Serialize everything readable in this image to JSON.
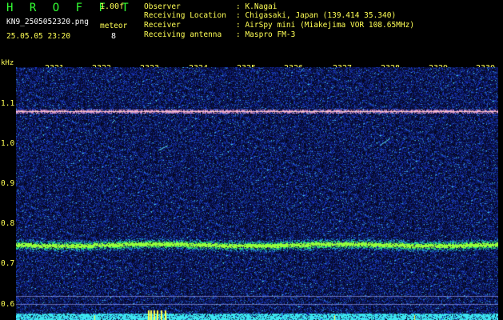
{
  "header": {
    "logo": "H R O F F T",
    "version": "1.00f",
    "filename": "KN9_2505052320.png",
    "meteor_label": "meteor",
    "datetime": "25.05.05 23:20",
    "meteor_count": "8",
    "info": [
      {
        "label": "Observer",
        "value": ": K.Nagai"
      },
      {
        "label": "Receiving Location",
        "value": ": Chigasaki, Japan (139.414 35.340)"
      },
      {
        "label": "Receiver",
        "value": ": AirSpy mini (Miakejima VOR 108.65MHz)"
      },
      {
        "label": "Receiving antenna",
        "value": ": Maspro FM-3"
      }
    ]
  },
  "axis": {
    "y_unit": "kHz",
    "x_ticks": [
      "2321",
      "2322",
      "2323",
      "2324",
      "2325",
      "2326",
      "2327",
      "2328",
      "2329",
      "2330"
    ],
    "y_ticks": [
      "1.1",
      "1.0",
      "0.9",
      "0.8",
      "0.7",
      "0.6"
    ]
  },
  "colors": {
    "background": "#000000",
    "label": "#ffff55",
    "title": "#33ff33",
    "noise": "#1a3a9a",
    "band_strong": "#66ff66",
    "band_top": "#ffb0d0"
  }
}
